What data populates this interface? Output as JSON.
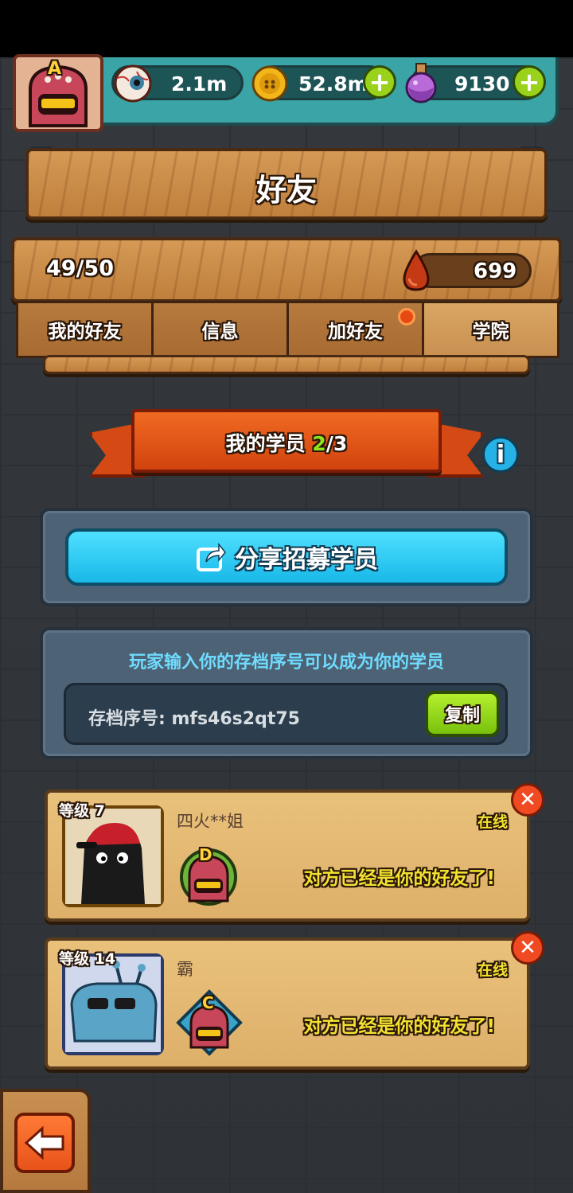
{
  "header": {
    "player_rank": "A",
    "eyes_value": "2.1m",
    "coins_value": "52.8m",
    "potion_value": "9130",
    "plus_symbol": "+"
  },
  "title": "好友",
  "friends_count": "49/50",
  "blood_value": "699",
  "tabs": [
    {
      "label": "我的好友",
      "active": false
    },
    {
      "label": "信息",
      "active": false
    },
    {
      "label": "加好友",
      "active": false,
      "notification": true
    },
    {
      "label": "学院",
      "active": true
    }
  ],
  "banner": {
    "label": "我的学员",
    "current": "2",
    "total_suffix": "/3"
  },
  "info_symbol": "i",
  "share_button_label": "分享招募学员",
  "instruction_text": "玩家输入你的存档序号可以成为你的学员",
  "save_code_text": "存档序号: mfs46s2qt75",
  "copy_button_label": "复制",
  "students": [
    {
      "level": "等级 7",
      "name": "四火**姐",
      "status": "在线",
      "rank": "D",
      "message": "对方已经是你的好友了!"
    },
    {
      "level": "等级 14",
      "name": "霸",
      "status": "在线",
      "rank": "C",
      "message": "对方已经是你的好友了!"
    }
  ],
  "colors": {
    "accent_green": "#9ad21b",
    "accent_blue": "#26b2e6",
    "status_yellow": "#f3e231",
    "banner_red": "#e0501a"
  }
}
